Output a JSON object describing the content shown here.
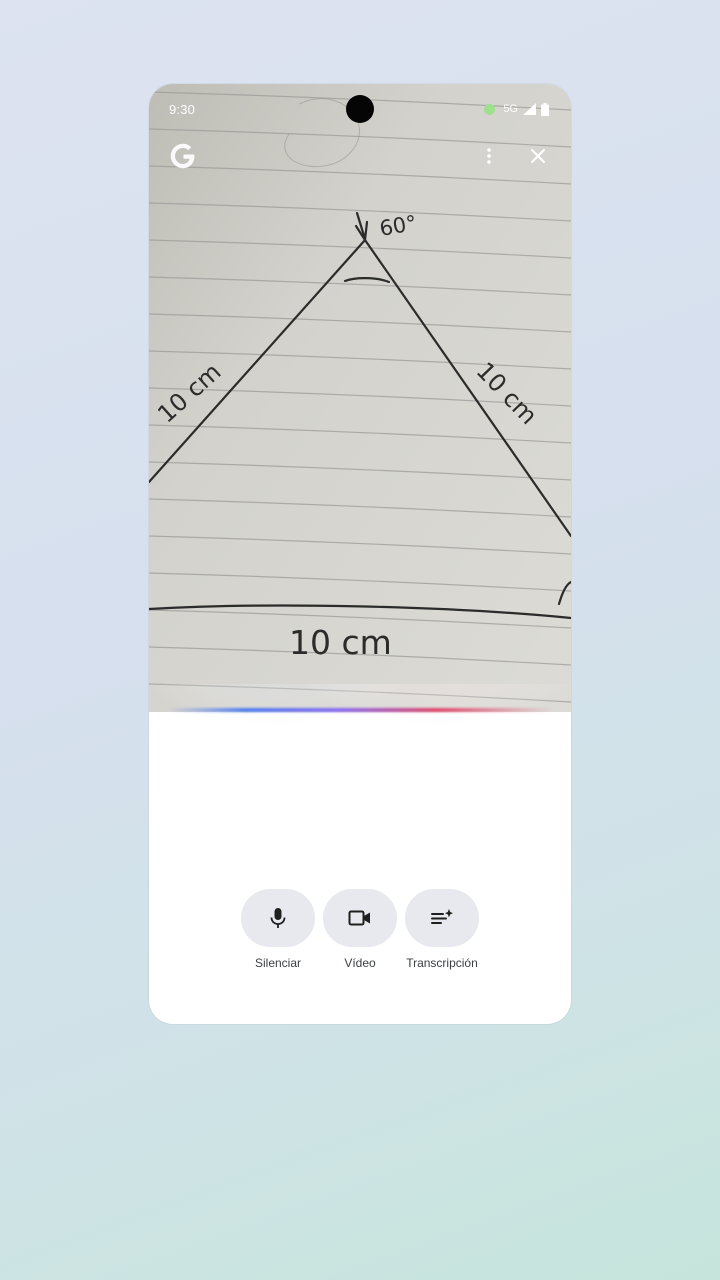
{
  "status_bar": {
    "time": "9:30",
    "network": "5G"
  },
  "top_bar": {
    "logo": "google-g-icon",
    "more_icon": "more-vertical-icon",
    "close_icon": "close-icon"
  },
  "camera_feed": {
    "drawing": {
      "apex_angle_label": "60°",
      "left_side_label": "10 cm",
      "right_side_label": "10 cm",
      "base_label": "10 cm"
    }
  },
  "controls": [
    {
      "label": "Silenciar",
      "icon": "microphone-icon"
    },
    {
      "label": "Vídeo",
      "icon": "video-camera-icon"
    },
    {
      "label": "Transcripción",
      "icon": "transcript-sparkle-icon"
    }
  ],
  "colors": {
    "control_bg": "#e7e9ee",
    "glow_blue": "#4f7df0",
    "glow_purple": "#8a6cf0",
    "glow_red": "#e0466a",
    "mic_active": "#9ee08c"
  }
}
